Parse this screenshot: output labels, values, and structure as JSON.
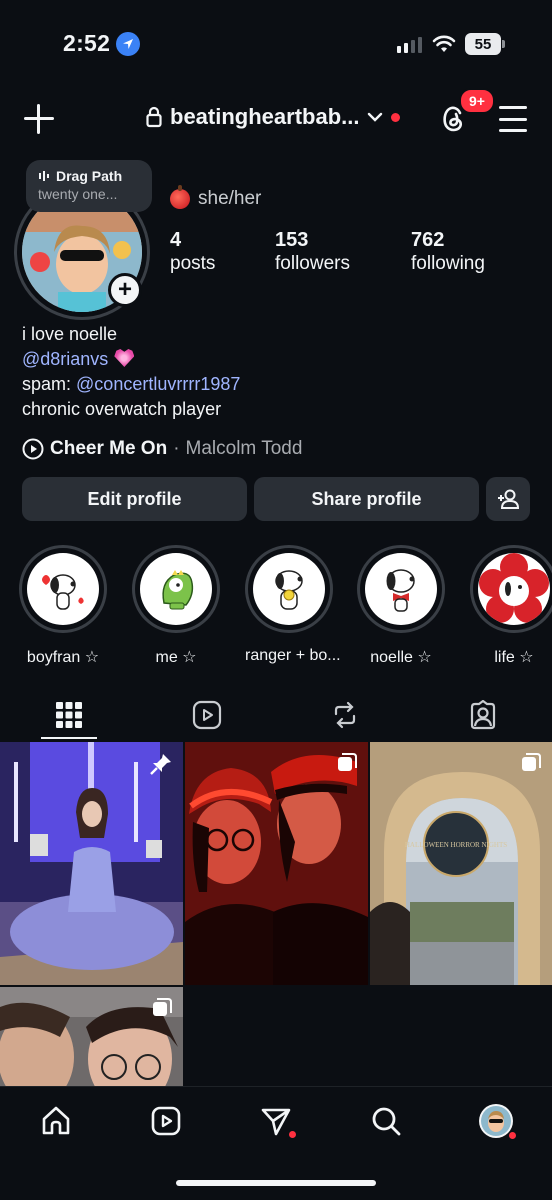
{
  "status_bar": {
    "time": "2:52",
    "battery": "55"
  },
  "header": {
    "username": "beatingheartbab...",
    "notif_badge": "9+"
  },
  "note": {
    "title": "Drag Path",
    "subtitle": "twenty one..."
  },
  "profile": {
    "pronouns": "she/her",
    "stats": [
      {
        "value": "4",
        "label": "posts"
      },
      {
        "value": "153",
        "label": "followers"
      },
      {
        "value": "762",
        "label": "following"
      }
    ],
    "bio": {
      "line1": "i love noelle",
      "mention1": "@d8rianvs",
      "spam_label": "spam: ",
      "mention2": "@concertluvrrrr1987",
      "line4": "chronic overwatch player"
    },
    "music": {
      "song": "Cheer Me On",
      "separator": " · ",
      "artist": "Malcolm Todd"
    }
  },
  "buttons": {
    "edit": "Edit profile",
    "share": "Share profile"
  },
  "highlights": [
    {
      "label": "boyfran ☆"
    },
    {
      "label": "me ☆"
    },
    {
      "label": "ranger + bo..."
    },
    {
      "label": "noelle ☆"
    },
    {
      "label": "life ☆"
    }
  ],
  "tabs": [
    "grid-icon",
    "reels-icon",
    "reposts-icon",
    "tagged-icon"
  ],
  "posts": [
    {
      "icon": "pin-icon"
    },
    {
      "icon": "carousel-icon"
    },
    {
      "icon": "carousel-icon",
      "sign_text": "HALLOWEEN HORROR NIGHTS"
    },
    {
      "icon": "carousel-icon"
    }
  ],
  "colors": {
    "accent_red": "#ff3040",
    "link": "#a0b5ff",
    "button_bg": "#2a2f36",
    "bg": "#0b0e13"
  }
}
